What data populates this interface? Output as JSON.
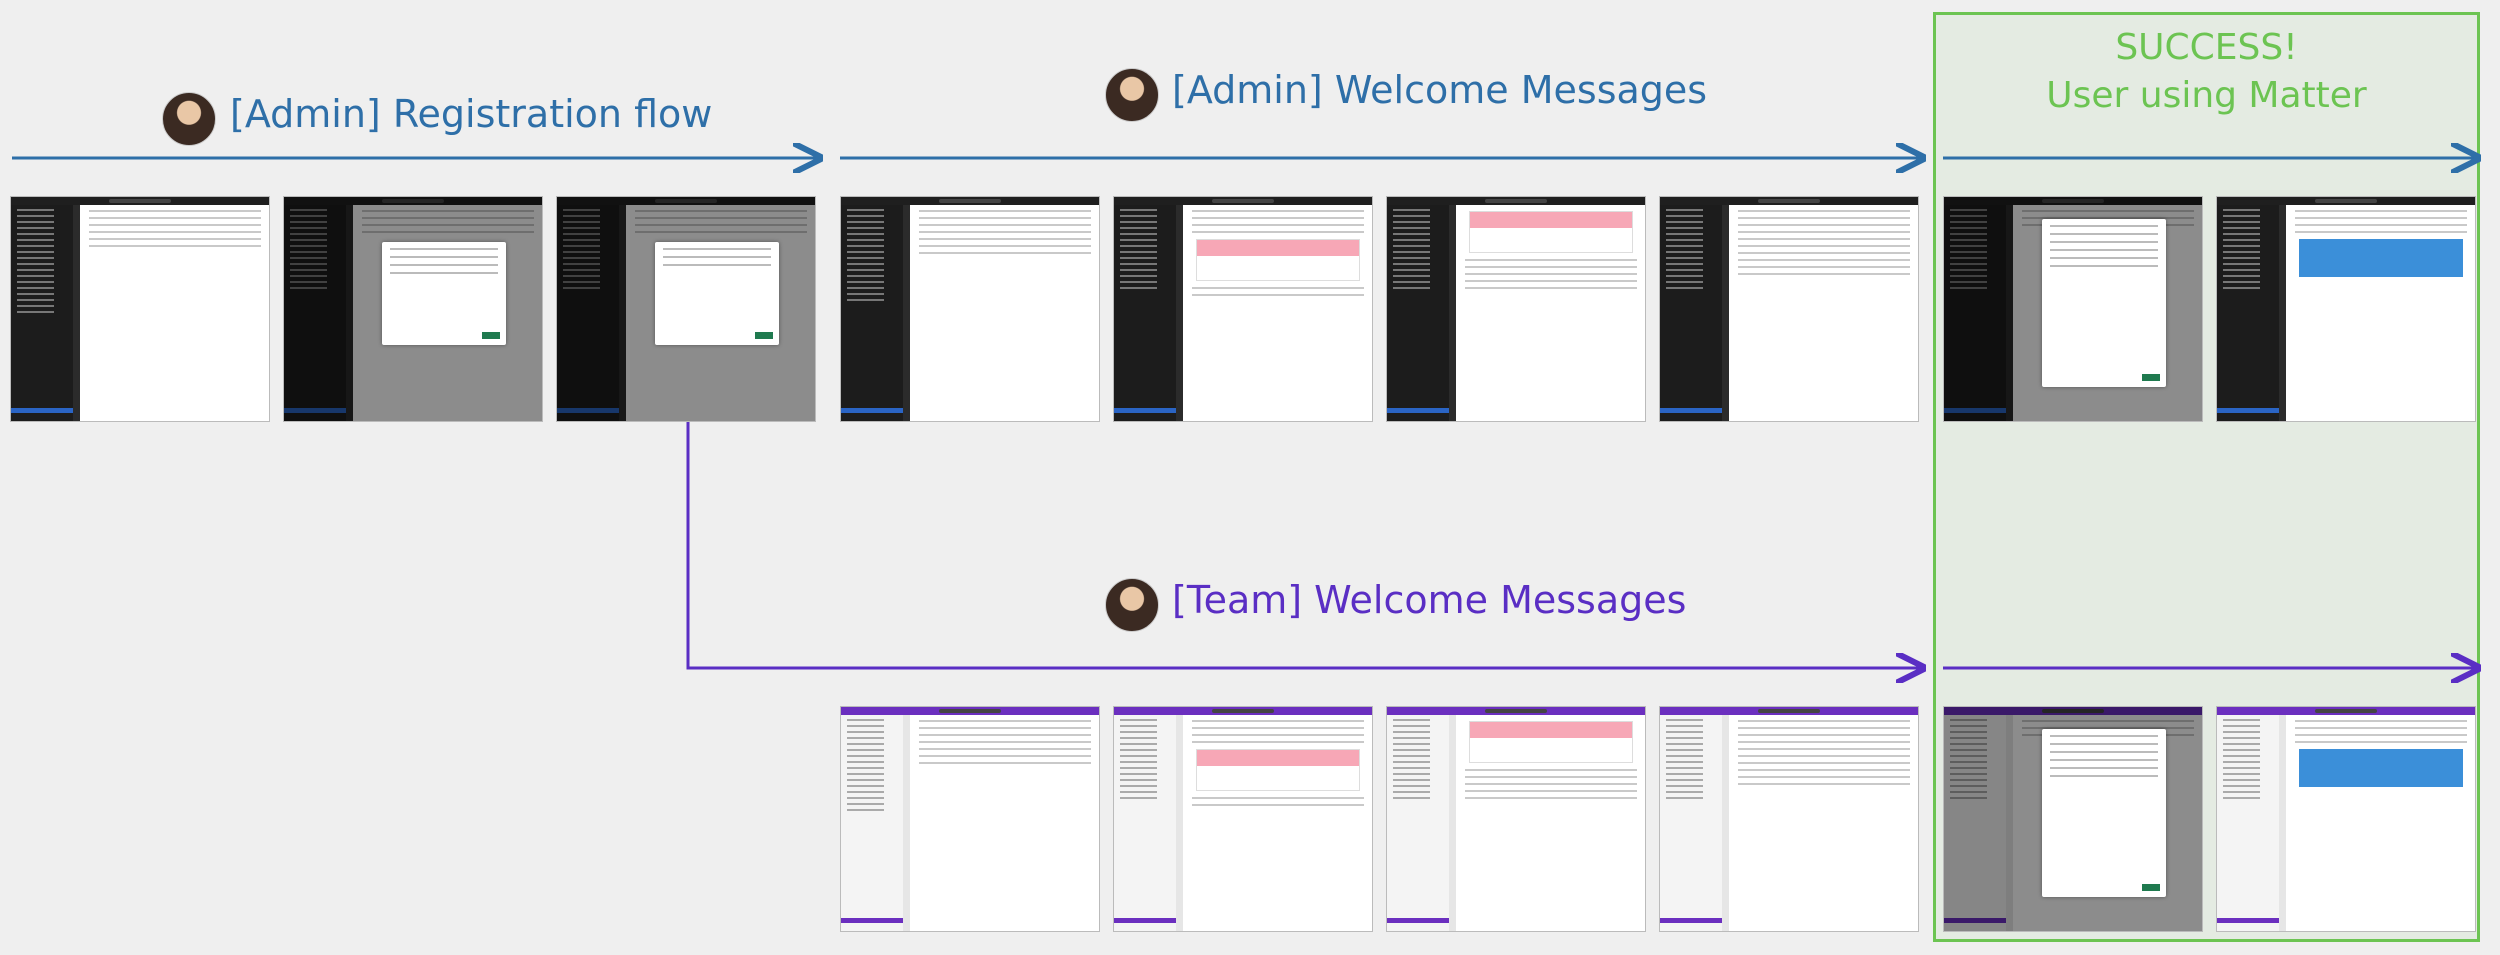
{
  "flows": {
    "admin_registration": {
      "title": "[Admin] Registration flow",
      "color": "#2e6fa8"
    },
    "admin_welcome": {
      "title": "[Admin] Welcome Messages",
      "color": "#2e6fa8"
    },
    "team_welcome": {
      "title": "[Team] Welcome Messages",
      "color": "#5a2ec4"
    }
  },
  "success": {
    "line1": "SUCCESS!",
    "line2": "User using Matter",
    "color": "#6cc452"
  }
}
